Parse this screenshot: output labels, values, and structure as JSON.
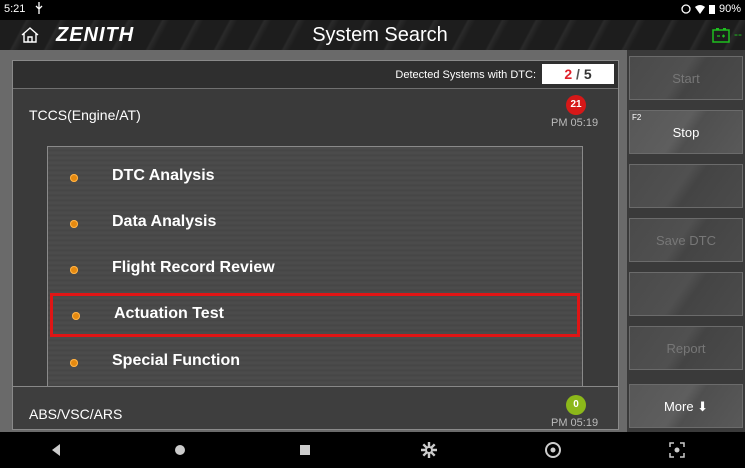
{
  "statusbar": {
    "time": "5:21",
    "battery_pct": "90%"
  },
  "header": {
    "logo": "ZENITH",
    "title": "System Search"
  },
  "dtc": {
    "label": "Detected Systems with DTC:",
    "current": "2",
    "separator": "/",
    "total": "5"
  },
  "systems": [
    {
      "name": "TCCS(Engine/AT)",
      "badge": "21",
      "time": "PM 05:19"
    },
    {
      "name": "ABS/VSC/ARS",
      "badge": "0",
      "time": "PM 05:19"
    }
  ],
  "menu": [
    {
      "label": "DTC Analysis"
    },
    {
      "label": "Data Analysis"
    },
    {
      "label": "Flight Record Review"
    },
    {
      "label": "Actuation Test",
      "selected": true
    },
    {
      "label": "Special Function"
    }
  ],
  "sidebar": {
    "start": {
      "label": "Start",
      "state": "disabled"
    },
    "stop": {
      "fkey": "F2",
      "label": "Stop"
    },
    "btn3": {
      "label": ""
    },
    "btn4": {
      "label": "Save DTC",
      "state": "disabled"
    },
    "btn5": {
      "label": ""
    },
    "btn6": {
      "label": "Report",
      "state": "disabled"
    },
    "more": {
      "label": "More ⬇"
    }
  },
  "colors": {
    "accent_red": "#e01515",
    "badge_red": "#d61818",
    "badge_green": "#8cb81a",
    "bullet": "#e68a10"
  },
  "icons": [
    "usb-icon",
    "home-icon",
    "battery-icon",
    "back-icon",
    "home-nav-icon",
    "recents-icon",
    "settings-icon",
    "chrome-icon",
    "screenshot-icon"
  ]
}
